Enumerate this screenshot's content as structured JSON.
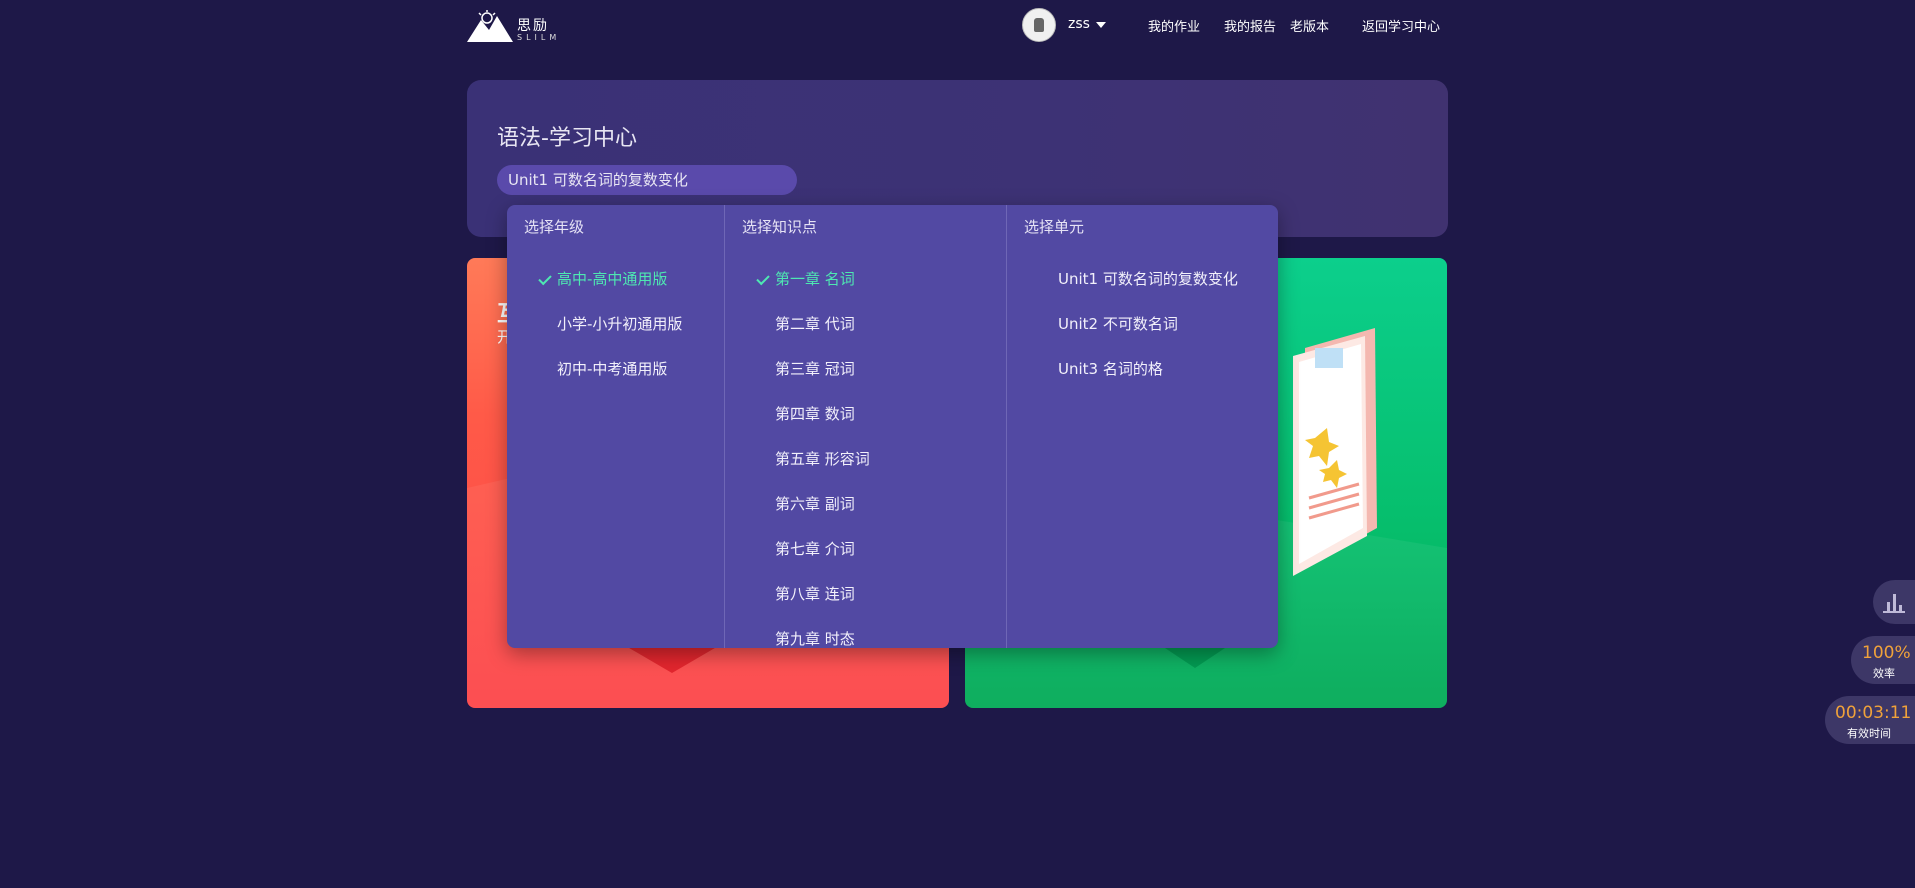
{
  "nav": {
    "logo_cn": "思励",
    "logo_en": "SLILM",
    "username": "zss",
    "links": [
      "我的作业",
      "我的报告",
      "老版本",
      "返回学习中心"
    ]
  },
  "header": {
    "title": "语法-学习中心",
    "selected_unit": "Unit1 可数名词的复数变化"
  },
  "cards": {
    "red": {
      "title": "互",
      "subtitle": "开"
    }
  },
  "dropdown": {
    "grade": {
      "label": "选择年级",
      "options": [
        "高中-高中通用版",
        "小学-小升初通用版",
        "初中-中考通用版"
      ],
      "selected": "高中-高中通用版"
    },
    "topic": {
      "label": "选择知识点",
      "options": [
        "第一章 名词",
        "第二章 代词",
        "第三章 冠词",
        "第四章 数词",
        "第五章 形容词",
        "第六章 副词",
        "第七章 介词",
        "第八章 连词",
        "第九章 时态"
      ],
      "selected": "第一章 名词"
    },
    "unit": {
      "label": "选择单元",
      "options": [
        "Unit1 可数名词的复数变化",
        "Unit2 不可数名词",
        "Unit3 名词的格"
      ]
    }
  },
  "widgets": {
    "stats_icon": "bar-chart-icon",
    "efficiency_value": "100%",
    "efficiency_label": "效率",
    "time_value": "00:03:11",
    "time_label": "有效时间"
  },
  "colors": {
    "background": "#1e1848",
    "panel": "#5249a3",
    "active": "#4ee8b2",
    "accent_orange": "#f0a23a"
  }
}
